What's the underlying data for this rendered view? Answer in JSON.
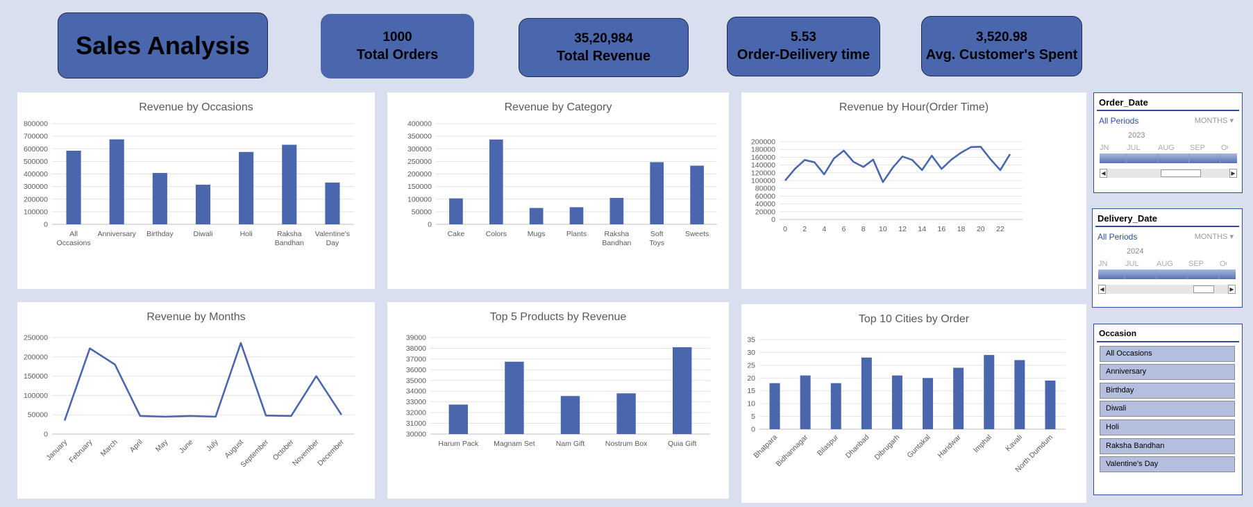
{
  "header": {
    "title": "Sales Analysis",
    "kpis": [
      {
        "value": "1000",
        "label": "Total Orders"
      },
      {
        "value": "35,20,984",
        "label": "Total Revenue"
      },
      {
        "value": "5.53",
        "label": "Order-Deilivery time"
      },
      {
        "value": "3,520.98",
        "label": "Avg. Customer's Spent"
      }
    ]
  },
  "colors": {
    "accent": "#4a66ad",
    "background": "#d9dfee",
    "bar": "#4a66ad"
  },
  "chart_data": [
    {
      "type": "bar",
      "title": "Revenue by Occasions",
      "categories": [
        "All Occasions",
        "Anniversary",
        "Birthday",
        "Diwali",
        "Holi",
        "Raksha Bandhan",
        "Valentine's Day"
      ],
      "values": [
        585000,
        675000,
        408000,
        315000,
        575000,
        632000,
        332000
      ],
      "ylim": [
        0,
        800000
      ],
      "yticks": [
        "0",
        "100000",
        "200000",
        "300000",
        "400000",
        "500000",
        "600000",
        "700000",
        "800000"
      ]
    },
    {
      "type": "bar",
      "title": "Revenue by Category",
      "categories": [
        "Cake",
        "Colors",
        "Mugs",
        "Plants",
        "Raksha Bandhan",
        "Soft Toys",
        "Sweets"
      ],
      "values": [
        103000,
        337000,
        65000,
        68000,
        105000,
        247000,
        233000
      ],
      "ylim": [
        0,
        400000
      ],
      "yticks": [
        "0",
        "50000",
        "100000",
        "150000",
        "200000",
        "250000",
        "300000",
        "350000",
        "400000"
      ]
    },
    {
      "type": "line",
      "title": "Revenue by Hour(Order Time)",
      "x": [
        0,
        1,
        2,
        3,
        4,
        5,
        6,
        7,
        8,
        9,
        10,
        11,
        12,
        13,
        14,
        15,
        16,
        17,
        18,
        19,
        20,
        21,
        22,
        23
      ],
      "values": [
        100000,
        130000,
        153000,
        147000,
        116000,
        157000,
        177000,
        148000,
        135000,
        154000,
        96000,
        133000,
        162000,
        153000,
        127000,
        164000,
        130000,
        154000,
        172000,
        186000,
        187000,
        155000,
        127000,
        168000
      ],
      "xticks": [
        "0",
        "2",
        "4",
        "6",
        "8",
        "10",
        "12",
        "14",
        "16",
        "18",
        "20",
        "22"
      ],
      "ylim": [
        0,
        200000
      ],
      "yticks": [
        "0",
        "20000",
        "40000",
        "60000",
        "80000",
        "100000",
        "120000",
        "140000",
        "160000",
        "180000",
        "200000"
      ]
    },
    {
      "type": "line",
      "title": "Revenue by Months",
      "categories": [
        "January",
        "February",
        "March",
        "April",
        "May",
        "June",
        "July",
        "August",
        "September",
        "October",
        "November",
        "December"
      ],
      "values": [
        35000,
        222000,
        180000,
        47000,
        45000,
        47000,
        45000,
        236000,
        48000,
        47000,
        150000,
        50000
      ],
      "ylim": [
        0,
        250000
      ],
      "yticks": [
        "0",
        "50000",
        "100000",
        "150000",
        "200000",
        "250000"
      ]
    },
    {
      "type": "bar",
      "title": "Top 5 Products by Revenue",
      "categories": [
        "Harum Pack",
        "Magnam Set",
        "Nam Gift",
        "Nostrum Box",
        "Quia Gift"
      ],
      "values": [
        32750,
        36750,
        33550,
        33800,
        38100
      ],
      "ylim": [
        30000,
        39000
      ],
      "yticks": [
        "30000",
        "31000",
        "32000",
        "33000",
        "34000",
        "35000",
        "36000",
        "37000",
        "38000",
        "39000"
      ]
    },
    {
      "type": "bar",
      "title": "Top 10 Cities by Order",
      "categories": [
        "Bhatpara",
        "Bidhannagar",
        "Bilaspur",
        "Dhanbad",
        "Dibrugarh",
        "Guntakal",
        "Haridwar",
        "Imphal",
        "Kavali",
        "North Dumdum"
      ],
      "values": [
        18,
        21,
        18,
        28,
        21,
        20,
        24,
        29,
        27,
        19
      ],
      "ylim": [
        0,
        35
      ],
      "yticks": [
        "0",
        "5",
        "10",
        "15",
        "20",
        "25",
        "30",
        "35"
      ]
    }
  ],
  "slicers": {
    "order_date": {
      "title": "Order_Date",
      "all": "All Periods",
      "level": "MONTHS",
      "year": "2023",
      "months": [
        "JN",
        "JUL",
        "AUG",
        "SEP",
        "OC"
      ]
    },
    "delivery_date": {
      "title": "Delivery_Date",
      "all": "All Periods",
      "level": "MONTHS",
      "year": "2024",
      "months": [
        "JN",
        "JUL",
        "AUG",
        "SEP",
        "OC"
      ]
    },
    "occasion": {
      "title": "Occasion",
      "items": [
        "All Occasions",
        "Anniversary",
        "Birthday",
        "Diwali",
        "Holi",
        "Raksha Bandhan",
        "Valentine's Day"
      ]
    }
  }
}
